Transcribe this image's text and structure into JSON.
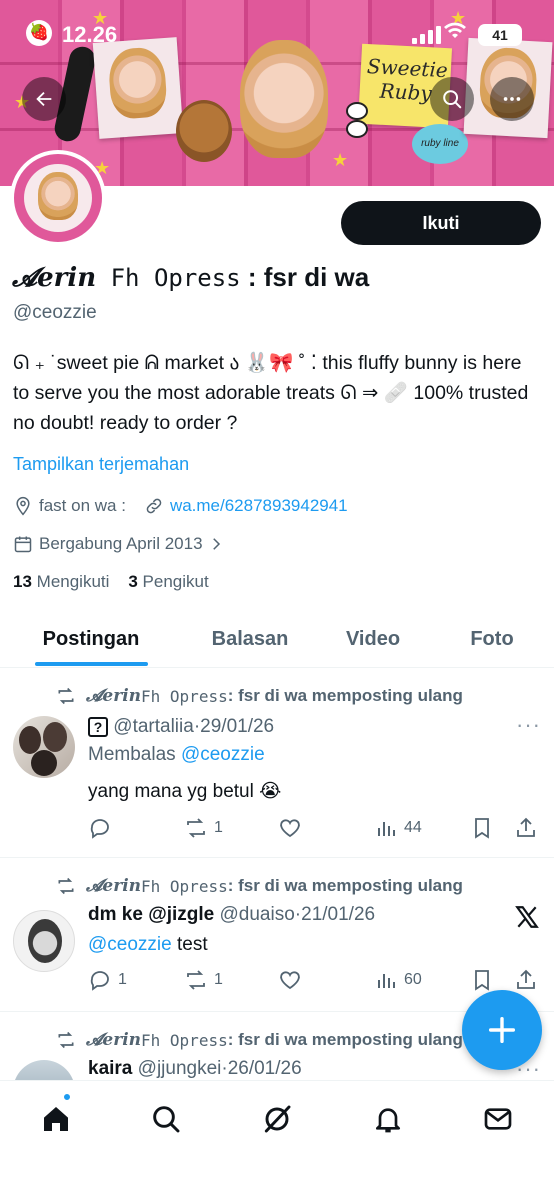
{
  "status_bar": {
    "time": "12.26",
    "battery": "41"
  },
  "profile": {
    "follow_label": "Ikuti",
    "name_part1": "𝓐erin",
    "name_part2": " Fh Opress",
    "name_part3": " : fsr di wa",
    "handle": "@ceozzie",
    "bio": "ᘏ ₊ ˙sweet pie ᕱ market ა 🐰🎀 ˚ ⁚ this fluffy bunny is here to serve you the most adorable treats ᘏ ⇒ 🩹 100% trusted no doubt! ready to order ?",
    "translate_label": "Tampilkan terjemahan",
    "location": "fast on wa :",
    "website": "wa.me/6287893942941",
    "joined": "Bergabung April 2013",
    "following_count": "13",
    "following_label": "Mengikuti",
    "followers_count": "3",
    "followers_label": "Pengikut"
  },
  "banner": {
    "sticky_text_1": "Sweetie",
    "sticky_text_2": "Ruby",
    "badge_text": "ruby line"
  },
  "tabs": [
    "Postingan",
    "Balasan",
    "Video",
    "Foto"
  ],
  "posts": [
    {
      "repost_name_1": "𝓐erin",
      "repost_name_2": " Fh Opress",
      "repost_name_3": " : fsr di wa memposting ulang",
      "author_name": "",
      "author_badge": "?",
      "handle": "@tartaliia",
      "date": "29/01/26",
      "reply_prefix": "Membalas",
      "reply_mention": "@ceozzie",
      "text": "yang mana yg betul 😭",
      "replies": "",
      "reposts": "1",
      "views": "44"
    },
    {
      "repost_name_1": "𝓐erin",
      "repost_name_2": " Fh Opress",
      "repost_name_3": " : fsr di wa memposting ulang",
      "author_name": "dm ke @jizgle",
      "handle": "@duaiso",
      "date": "21/01/26",
      "mention": "@ceozzie",
      "text": " test",
      "replies": "1",
      "reposts": "1",
      "views": "60"
    },
    {
      "repost_name_1": "𝓐erin",
      "repost_name_2": " Fh Opress",
      "repost_name_3": " : fsr di wa memposting ulang",
      "author_name": "kaira",
      "handle": "@jjungkei",
      "date": "26/01/26"
    }
  ]
}
